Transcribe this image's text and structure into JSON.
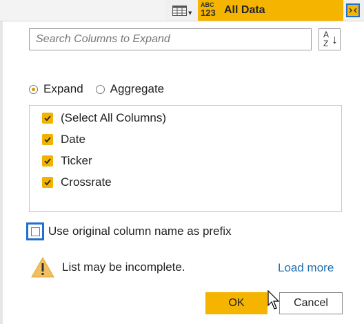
{
  "header": {
    "type_badge_top": "ABC",
    "type_badge_bottom": "123",
    "column_title": "All Data",
    "table_icon": "table-icon",
    "expand_icon": "expand-columns-icon"
  },
  "search": {
    "placeholder": "Search Columns to Expand",
    "value": ""
  },
  "sort_button": {
    "icon": "sort-a-z-icon",
    "top_letter": "A",
    "bottom_letter": "Z"
  },
  "mode": {
    "options": [
      {
        "label": "Expand",
        "selected": true
      },
      {
        "label": "Aggregate",
        "selected": false
      }
    ]
  },
  "columns": {
    "items": [
      {
        "label": "(Select All Columns)",
        "checked": true
      },
      {
        "label": "Date",
        "checked": true
      },
      {
        "label": "Ticker",
        "checked": true
      },
      {
        "label": "Crossrate",
        "checked": true
      }
    ]
  },
  "prefix": {
    "label": "Use original column name as prefix",
    "checked": false
  },
  "warning": {
    "text": "List may be incomplete.",
    "icon": "warning-icon"
  },
  "load_more": "Load more",
  "buttons": {
    "ok": "OK",
    "cancel": "Cancel"
  },
  "colors": {
    "accent": "#f4b400",
    "highlight": "#1f6fd0",
    "link": "#1f6fb0"
  }
}
